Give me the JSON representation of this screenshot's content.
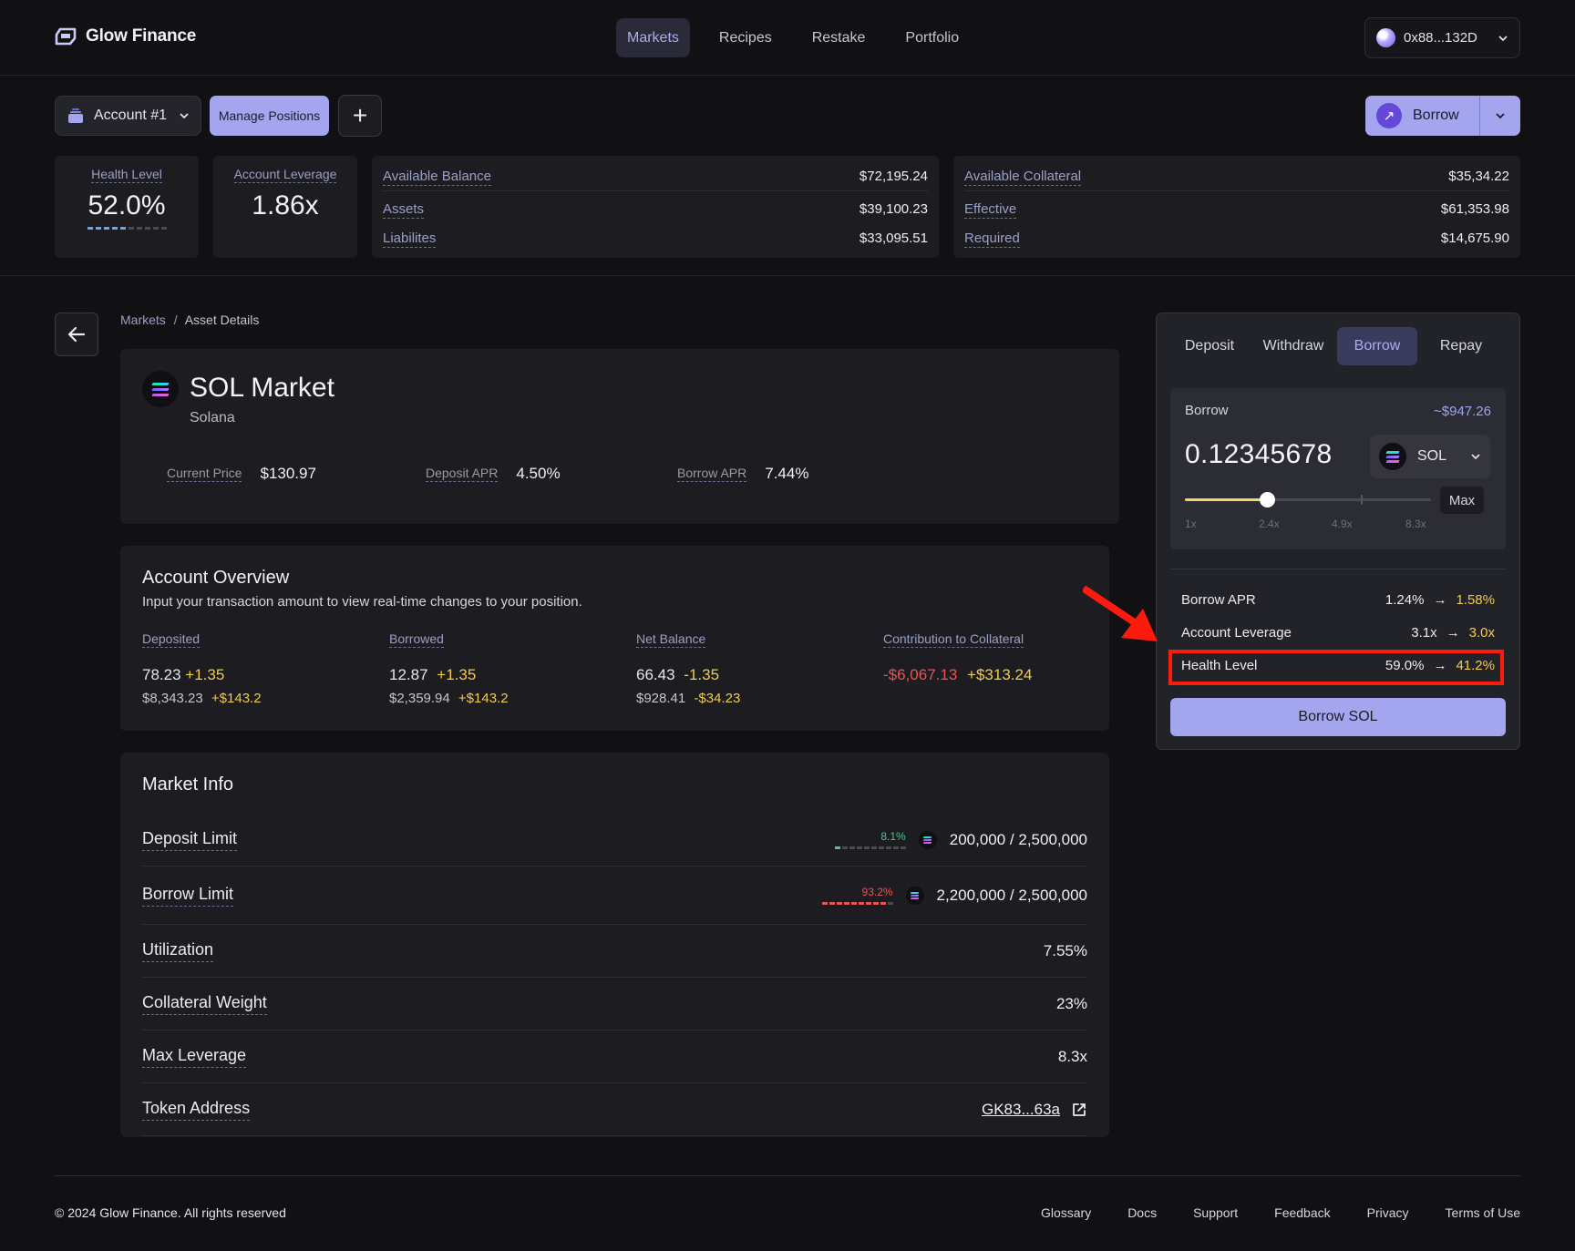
{
  "header": {
    "brand": "Glow Finance",
    "nav": [
      {
        "label": "Markets",
        "active": true
      },
      {
        "label": "Recipes",
        "active": false
      },
      {
        "label": "Restake",
        "active": false
      },
      {
        "label": "Portfolio",
        "active": false
      }
    ],
    "wallet": "0x88...132D"
  },
  "account_bar": {
    "account": "Account #1",
    "manage": "Manage Positions",
    "add": "+",
    "borrow": "Borrow"
  },
  "stats": {
    "health_label": "Health Level",
    "health_value": "52.0%",
    "health_fraction": 0.52,
    "leverage_label": "Account Leverage",
    "leverage_value": "1.86x",
    "balance": [
      {
        "label": "Available Balance",
        "value": "$72,195.24"
      },
      {
        "label": "Assets",
        "value": "$39,100.23"
      },
      {
        "label": "Liabilites",
        "value": "$33,095.51"
      }
    ],
    "collateral": [
      {
        "label": "Available Collateral",
        "value": "$35,34.22"
      },
      {
        "label": "Effective",
        "value": "$61,353.98"
      },
      {
        "label": "Required",
        "value": "$14,675.90"
      }
    ]
  },
  "breadcrumb": {
    "root": "Markets",
    "sep": "/",
    "current": "Asset Details"
  },
  "market": {
    "title": "SOL Market",
    "subtitle": "Solana",
    "metrics": [
      {
        "label": "Current Price",
        "value": "$130.97"
      },
      {
        "label": "Deposit APR",
        "value": "4.50%"
      },
      {
        "label": "Borrow APR",
        "value": "7.44%"
      }
    ]
  },
  "overview": {
    "title": "Account Overview",
    "subtitle": "Input your transaction amount to view real-time changes to your position.",
    "columns": [
      {
        "label": "Deposited",
        "v1": "78.23",
        "d1": "+1.35",
        "v2": "$8,343.23",
        "d2": "+$143.2"
      },
      {
        "label": "Borrowed",
        "v1": "12.87",
        "d1": "+1.35",
        "v2": "$2,359.94",
        "d2": "+$143.2"
      },
      {
        "label": "Net Balance",
        "v1": "66.43",
        "d1": "-1.35",
        "v2": "$928.41",
        "d2": "-$34.23"
      },
      {
        "label": "Contribution to Collateral",
        "v1": "-$6,067.13",
        "d1": "+$313.24",
        "v2": "",
        "d2": ""
      }
    ]
  },
  "market_info": {
    "title": "Market Info",
    "deposit_limit": {
      "label": "Deposit Limit",
      "pct": "8.1%",
      "fraction": 0.081,
      "value": "200,000",
      "sep": " / ",
      "max": "2,500,000"
    },
    "borrow_limit": {
      "label": "Borrow Limit",
      "pct": "93.2%",
      "fraction": 0.932,
      "value": "2,200,000",
      "sep": " / ",
      "max": "2,500,000"
    },
    "utilization": {
      "label": "Utilization",
      "value": "7.55%"
    },
    "collateral_weight": {
      "label": "Collateral Weight",
      "value": "23%"
    },
    "max_leverage": {
      "label": "Max Leverage",
      "value": "8.3x"
    },
    "token_address": {
      "label": "Token Address",
      "value": "GK83...63a"
    }
  },
  "panel": {
    "tabs": [
      {
        "label": "Deposit",
        "active": false
      },
      {
        "label": "Withdraw",
        "active": false
      },
      {
        "label": "Borrow",
        "active": true
      },
      {
        "label": "Repay",
        "active": false
      }
    ],
    "input_label": "Borrow",
    "usd_estimate": "~$947.26",
    "amount": "0.12345678",
    "token": "SOL",
    "max": "Max",
    "slider_ticks": [
      "1x",
      "2.4x",
      "4.9x",
      "8.3x"
    ],
    "slider_value": "2.4x",
    "rows": [
      {
        "label": "Borrow APR",
        "from": "1.24%",
        "arrow": "→",
        "to": "1.58%"
      },
      {
        "label": "Account Leverage",
        "from": "3.1x",
        "arrow": "→",
        "to": "3.0x"
      },
      {
        "label": "Health Level",
        "from": "59.0%",
        "arrow": "→",
        "to": "41.2%"
      }
    ],
    "cta": "Borrow SOL"
  },
  "footer": {
    "copyright": "© 2024 Glow Finance. All rights reserved",
    "links": [
      "Glossary",
      "Docs",
      "Support",
      "Feedback",
      "Privacy",
      "Terms of Use"
    ]
  },
  "colors": {
    "accent": "#a3a6ee",
    "positive_delta": "#f3cc4a",
    "negative": "#ef5350",
    "annotation": "#ff1a0e"
  }
}
